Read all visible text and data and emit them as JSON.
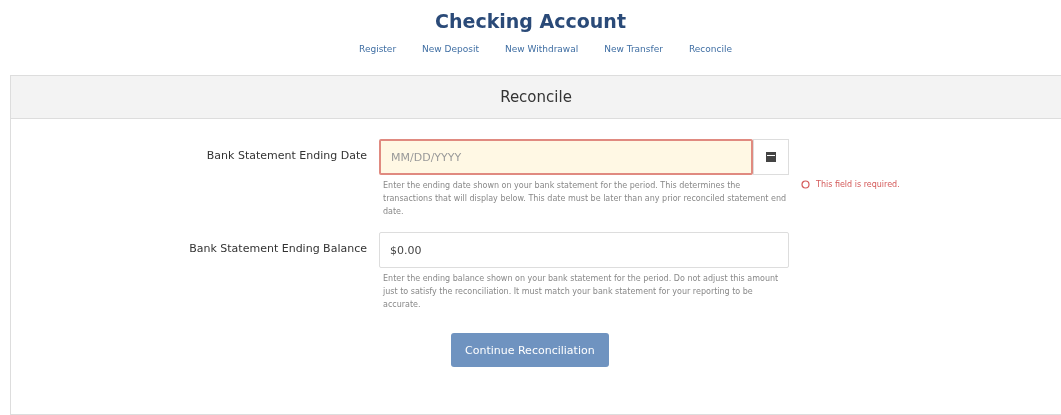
{
  "title": "Checking Account",
  "nav": [
    {
      "label": "Register"
    },
    {
      "label": "New Deposit"
    },
    {
      "label": "New Withdrawal"
    },
    {
      "label": "New Transfer"
    },
    {
      "label": "Reconcile"
    }
  ],
  "panel": {
    "title": "Reconcile"
  },
  "fields": [
    {
      "kind": "date",
      "label": "Bank Statement Ending Date",
      "placeholder": "MM/DD/YYYY",
      "invalid": true,
      "error": "This field is required.",
      "help": "Enter the ending date shown on your bank statement for the period. This determines the transactions that will display below. This date must be later than any prior reconciled statement end date."
    },
    {
      "kind": "text",
      "label": "Bank Statement Ending Balance",
      "value": "$0.00",
      "invalid": false,
      "help": "Enter the ending balance shown on your bank statement for the period. Do not adjust this amount just to satisfy the reconciliation. It must match your bank statement for your reporting to be accurate."
    }
  ],
  "submit": {
    "label": "Continue Reconciliation"
  }
}
